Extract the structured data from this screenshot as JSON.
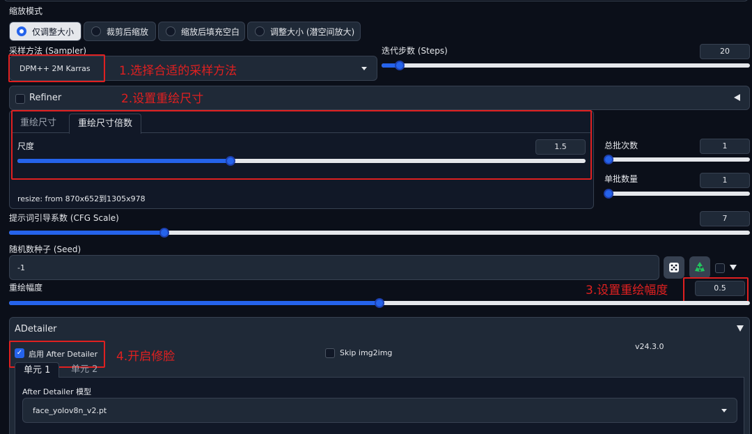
{
  "resize_mode": {
    "label": "缩放模式",
    "options": [
      "仅调整大小",
      "裁剪后缩放",
      "缩放后填充空白",
      "调整大小 (潜空间放大)"
    ],
    "selected": "仅调整大小"
  },
  "sampler": {
    "label": "采样方法 (Sampler)",
    "value": "DPM++ 2M Karras"
  },
  "steps": {
    "label": "迭代步数 (Steps)",
    "value": "20",
    "fraction": 0.05
  },
  "refiner": {
    "label": "Refiner",
    "collapse_icon": "triangle-left-icon"
  },
  "resize_tabs": {
    "tabs": [
      "重绘尺寸",
      "重绘尺寸倍数"
    ],
    "active": "重绘尺寸倍数"
  },
  "scale": {
    "label": "尺度",
    "value": "1.5",
    "fraction": 0.375,
    "info": "resize: from 870x652到1305x978"
  },
  "batch_count": {
    "label": "总批次数",
    "value": "1",
    "fraction": 0.0
  },
  "batch_size": {
    "label": "单批数量",
    "value": "1",
    "fraction": 0.0
  },
  "cfg": {
    "label": "提示词引导系数 (CFG Scale)",
    "value": "7",
    "fraction": 0.21
  },
  "seed": {
    "label": "随机数种子 (Seed)",
    "value": "-1",
    "random_icon": "dice-icon",
    "reuse_icon": "recycle-icon"
  },
  "denoise": {
    "label": "重绘幅度",
    "value": "0.5",
    "fraction": 0.5
  },
  "adetailer": {
    "title": "ADetailer",
    "enable_label": "启用 After Detailer",
    "enable_checked": true,
    "skip_label": "Skip img2img",
    "version": "v24.3.0",
    "tabs": [
      "单元 1",
      "单元 2"
    ],
    "model_label": "After Detailer 模型",
    "model_value": "face_yolov8n_v2.pt"
  },
  "annotations": {
    "a1": "1.选择合适的采样方法",
    "a2": "2.设置重绘尺寸",
    "a3": "3.设置重绘幅度",
    "a4": "4.开启修脸"
  },
  "colors": {
    "accent": "#2563eb",
    "annotation": "#e02020",
    "background": "#0b0f19",
    "panel": "#1f2937"
  }
}
